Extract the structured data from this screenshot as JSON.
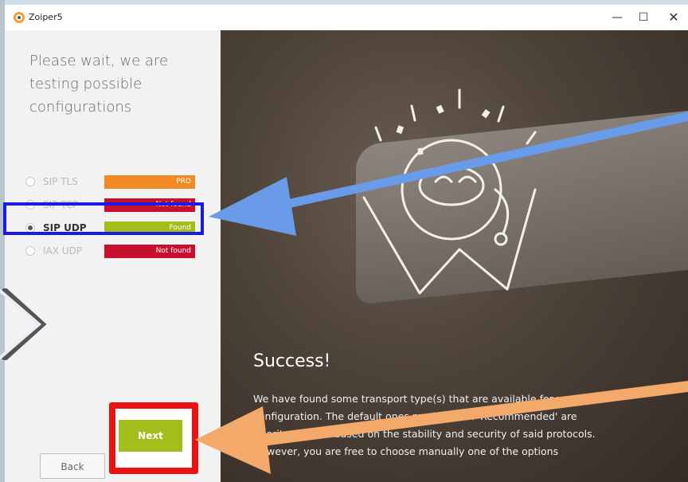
{
  "window": {
    "title": "Zoiper5",
    "minimize_glyph": "—",
    "maximize_glyph": "☐",
    "close_glyph": "✕"
  },
  "left": {
    "heading": "Please wait, we are testing possible configurations",
    "protocols": [
      {
        "label": "SIP TLS",
        "status": "PRO",
        "color": "#f08a24",
        "selected": false
      },
      {
        "label": "SIP TCP",
        "status": "Not found",
        "color": "#c8102e",
        "selected": false
      },
      {
        "label": "SIP UDP",
        "status": "Found",
        "color": "#a3bd1a",
        "selected": true
      },
      {
        "label": "IAX UDP",
        "status": "Not found",
        "color": "#c8102e",
        "selected": false
      }
    ],
    "back_label": "Back",
    "next_label": "Next"
  },
  "right": {
    "title": "Success!",
    "body": "We have found some transport type(s) that are available for your configuration. The default ones marked with 'Recommended' are priority ordered based on the stability and security of said protocols. However, you are free to choose manually one of the options"
  },
  "annotations": {
    "highlight_color": "#1a1ae6",
    "next_highlight_color": "#ee1111",
    "arrow_blue": "#6a9be8",
    "arrow_orange": "#f2a96a"
  }
}
